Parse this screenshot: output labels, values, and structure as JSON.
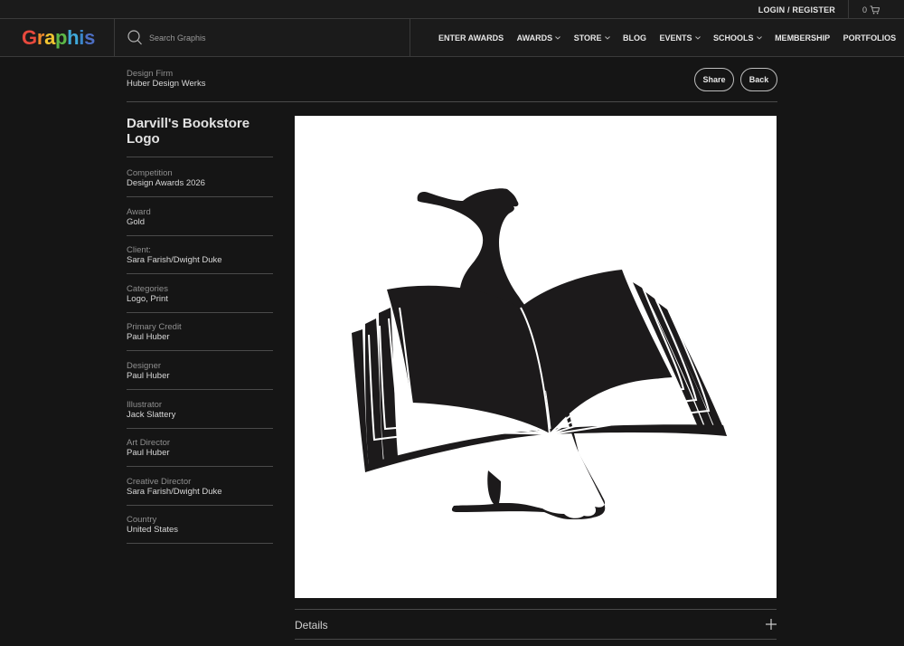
{
  "topbar": {
    "login_label": "LOGIN / REGISTER",
    "cart_count": "0"
  },
  "brand": {
    "letters": [
      {
        "ch": "G",
        "color": "#e8493d"
      },
      {
        "ch": "r",
        "color": "#f08a2c"
      },
      {
        "ch": "a",
        "color": "#f2c531"
      },
      {
        "ch": "p",
        "color": "#5cb848"
      },
      {
        "ch": "h",
        "color": "#3fa9d9"
      },
      {
        "ch": "i",
        "color": "#3b86c9"
      },
      {
        "ch": "s",
        "color": "#4d6fc4"
      }
    ]
  },
  "search": {
    "placeholder": "Search Graphis"
  },
  "nav": [
    {
      "label": "ENTER AWARDS",
      "dropdown": false
    },
    {
      "label": "AWARDS",
      "dropdown": true
    },
    {
      "label": "STORE",
      "dropdown": true
    },
    {
      "label": "BLOG",
      "dropdown": false
    },
    {
      "label": "EVENTS",
      "dropdown": true
    },
    {
      "label": "SCHOOLS",
      "dropdown": true
    },
    {
      "label": "MEMBERSHIP",
      "dropdown": false
    },
    {
      "label": "PORTFOLIOS",
      "dropdown": false
    }
  ],
  "firm": {
    "label": "Design Firm",
    "value": "Huber Design Werks"
  },
  "actions": {
    "share_label": "Share",
    "back_label": "Back"
  },
  "entry": {
    "title": "Darvill's Bookstore Logo",
    "meta": [
      {
        "label": "Competition",
        "value": "Design Awards 2026"
      },
      {
        "label": "Award",
        "value": "Gold"
      },
      {
        "label": "Client:",
        "value": "Sara Farish/Dwight Duke"
      },
      {
        "label": "Categories",
        "value": "Logo, Print"
      },
      {
        "label": "Primary Credit",
        "value": "Paul Huber"
      },
      {
        "label": "Designer",
        "value": "Paul Huber"
      },
      {
        "label": "Illustrator",
        "value": "Jack Slattery"
      },
      {
        "label": "Art Director",
        "value": "Paul Huber"
      },
      {
        "label": "Creative Director",
        "value": "Sara Farish/Dwight Duke"
      },
      {
        "label": "Country",
        "value": "United States"
      }
    ]
  },
  "details": {
    "label": "Details"
  },
  "icons": {
    "search": "search-icon",
    "cart": "cart-icon",
    "expand": "plus-icon",
    "dropdown": "chevron-down-icon"
  }
}
